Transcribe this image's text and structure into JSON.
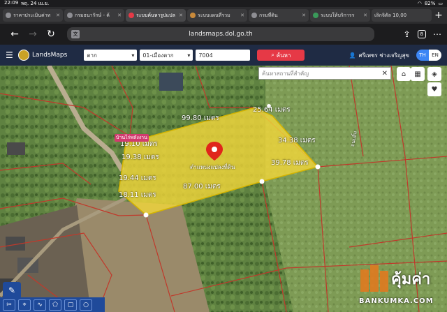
{
  "statusbar": {
    "time": "22:09",
    "date": "พฤ. 24 เม.ย.",
    "battery": "82%"
  },
  "browser_tabs": [
    {
      "label": "ราคาประเมินค่าท",
      "active": false
    },
    {
      "label": "กรมธนารักษ์ - ค้",
      "active": false
    },
    {
      "label": "ระบบค้นหารูปแปล",
      "active": true
    },
    {
      "label": "ระบบแผนที่รวม",
      "active": false
    },
    {
      "label": "กรมที่ดิน",
      "active": false
    },
    {
      "label": "ระบบให้บริการร",
      "active": false
    },
    {
      "label": "เลิกจิตัล 10,00",
      "active": false
    }
  ],
  "address": {
    "url": "landsmaps.dol.go.th",
    "translate_icon": "translate-icon",
    "tab_count": "8"
  },
  "app": {
    "name": "LandsMaps",
    "province": "ตาก",
    "district": "01-เมืองตาก",
    "parcel_number": "7004",
    "search_label": "ค้นหา",
    "user_name": "ศรีเพชร ช่างเจริญสุข",
    "lang_th": "TH",
    "lang_en": "EN"
  },
  "map": {
    "place_search_placeholder": "ค้นหาสถานที่สำคัญ",
    "parcel_label": "ตำแหน่งแปลงที่ดิน",
    "road_label": "ถนนยิ้ม",
    "house_label": "บ้านไร่พลังงาน",
    "measurements": [
      "99.80 เมตร",
      "25.64 เมตร",
      "19.10 เมตร",
      "34.38 เมตร",
      "19.38 เมตร",
      "39.78 เมตร",
      "19.44 เมตร",
      "87.00 เมตร",
      "18.11 เมตร"
    ],
    "parcel_fill": "#f0d63a",
    "boundary_color": "#c0392b"
  },
  "watermark": {
    "text": "คุ้มค่า",
    "domain": "BANKUMKA.COM"
  }
}
